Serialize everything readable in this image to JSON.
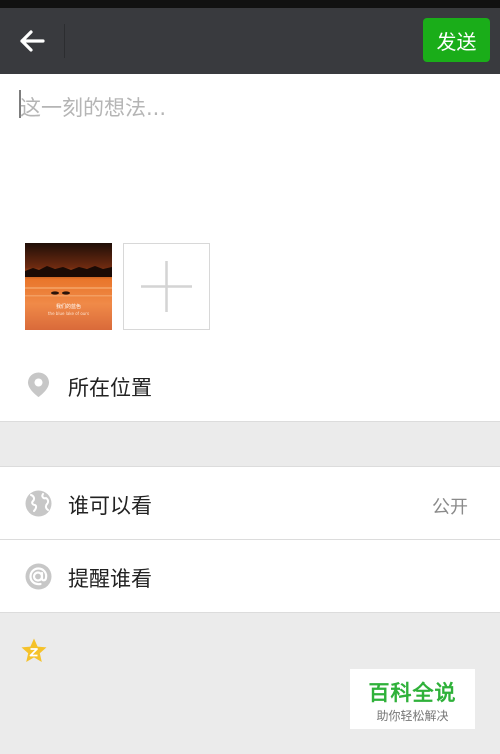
{
  "header": {
    "send_label": "发送"
  },
  "compose": {
    "placeholder": "这一刻的想法..."
  },
  "photo": {
    "caption_line1": "我们的蓝色",
    "caption_line2": "the blue lake of ours"
  },
  "options": {
    "location_label": "所在位置",
    "visibility_label": "谁可以看",
    "visibility_value": "公开",
    "mention_label": "提醒谁看"
  },
  "watermark": {
    "title": "百科全说",
    "subtitle": "助你轻松解决"
  },
  "colors": {
    "topbar": "#393a3e",
    "send_button": "#1aad19",
    "icon_gray": "#c7c7c7",
    "star": "#f5c22a"
  },
  "icons": {
    "back": "arrow-left",
    "add": "plus",
    "location": "location-pin",
    "visibility": "globe",
    "mention": "at-sign",
    "favorite": "star"
  }
}
